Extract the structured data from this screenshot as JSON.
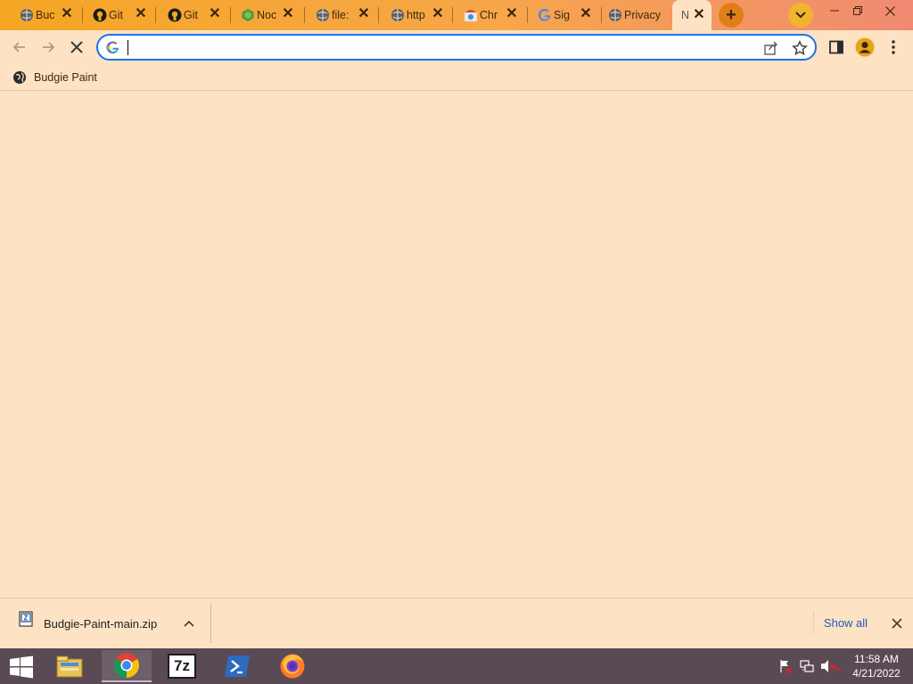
{
  "tabs": [
    {
      "title": "Buc",
      "icon": "globe-icon"
    },
    {
      "title": "Git",
      "icon": "github-icon"
    },
    {
      "title": "Git",
      "icon": "github-icon"
    },
    {
      "title": "Noc",
      "icon": "nodejs-icon"
    },
    {
      "title": "file:",
      "icon": "globe-icon"
    },
    {
      "title": "http",
      "icon": "globe-icon"
    },
    {
      "title": "Chr",
      "icon": "chrome-web-store-icon"
    },
    {
      "title": "Sig",
      "icon": "google-icon"
    },
    {
      "title": "Privacy",
      "icon": "globe-icon"
    },
    {
      "title": "N",
      "icon": "none",
      "active": true
    }
  ],
  "omnibox": {
    "value": "",
    "placeholder": ""
  },
  "bookmarks": [
    {
      "label": "Budgie Paint",
      "icon": "globe-icon"
    }
  ],
  "download": {
    "filename": "Budgie-Paint-main.zip",
    "show_all": "Show all"
  },
  "taskbar": {
    "apps": [
      "file-explorer-icon",
      "chrome-icon",
      "7zip-icon",
      "powershell-icon",
      "firefox-icon"
    ],
    "time": "11:58 AM",
    "date": "4/21/2022",
    "sevenzip_label": "7z"
  },
  "colors": {
    "tabstrip_start": "#f5a623",
    "tabstrip_end": "#f08a73",
    "page_bg": "#fde3c3",
    "omnibox_focus": "#1a73e8",
    "taskbar": "#5a4a54",
    "link": "#1a5cc4"
  }
}
